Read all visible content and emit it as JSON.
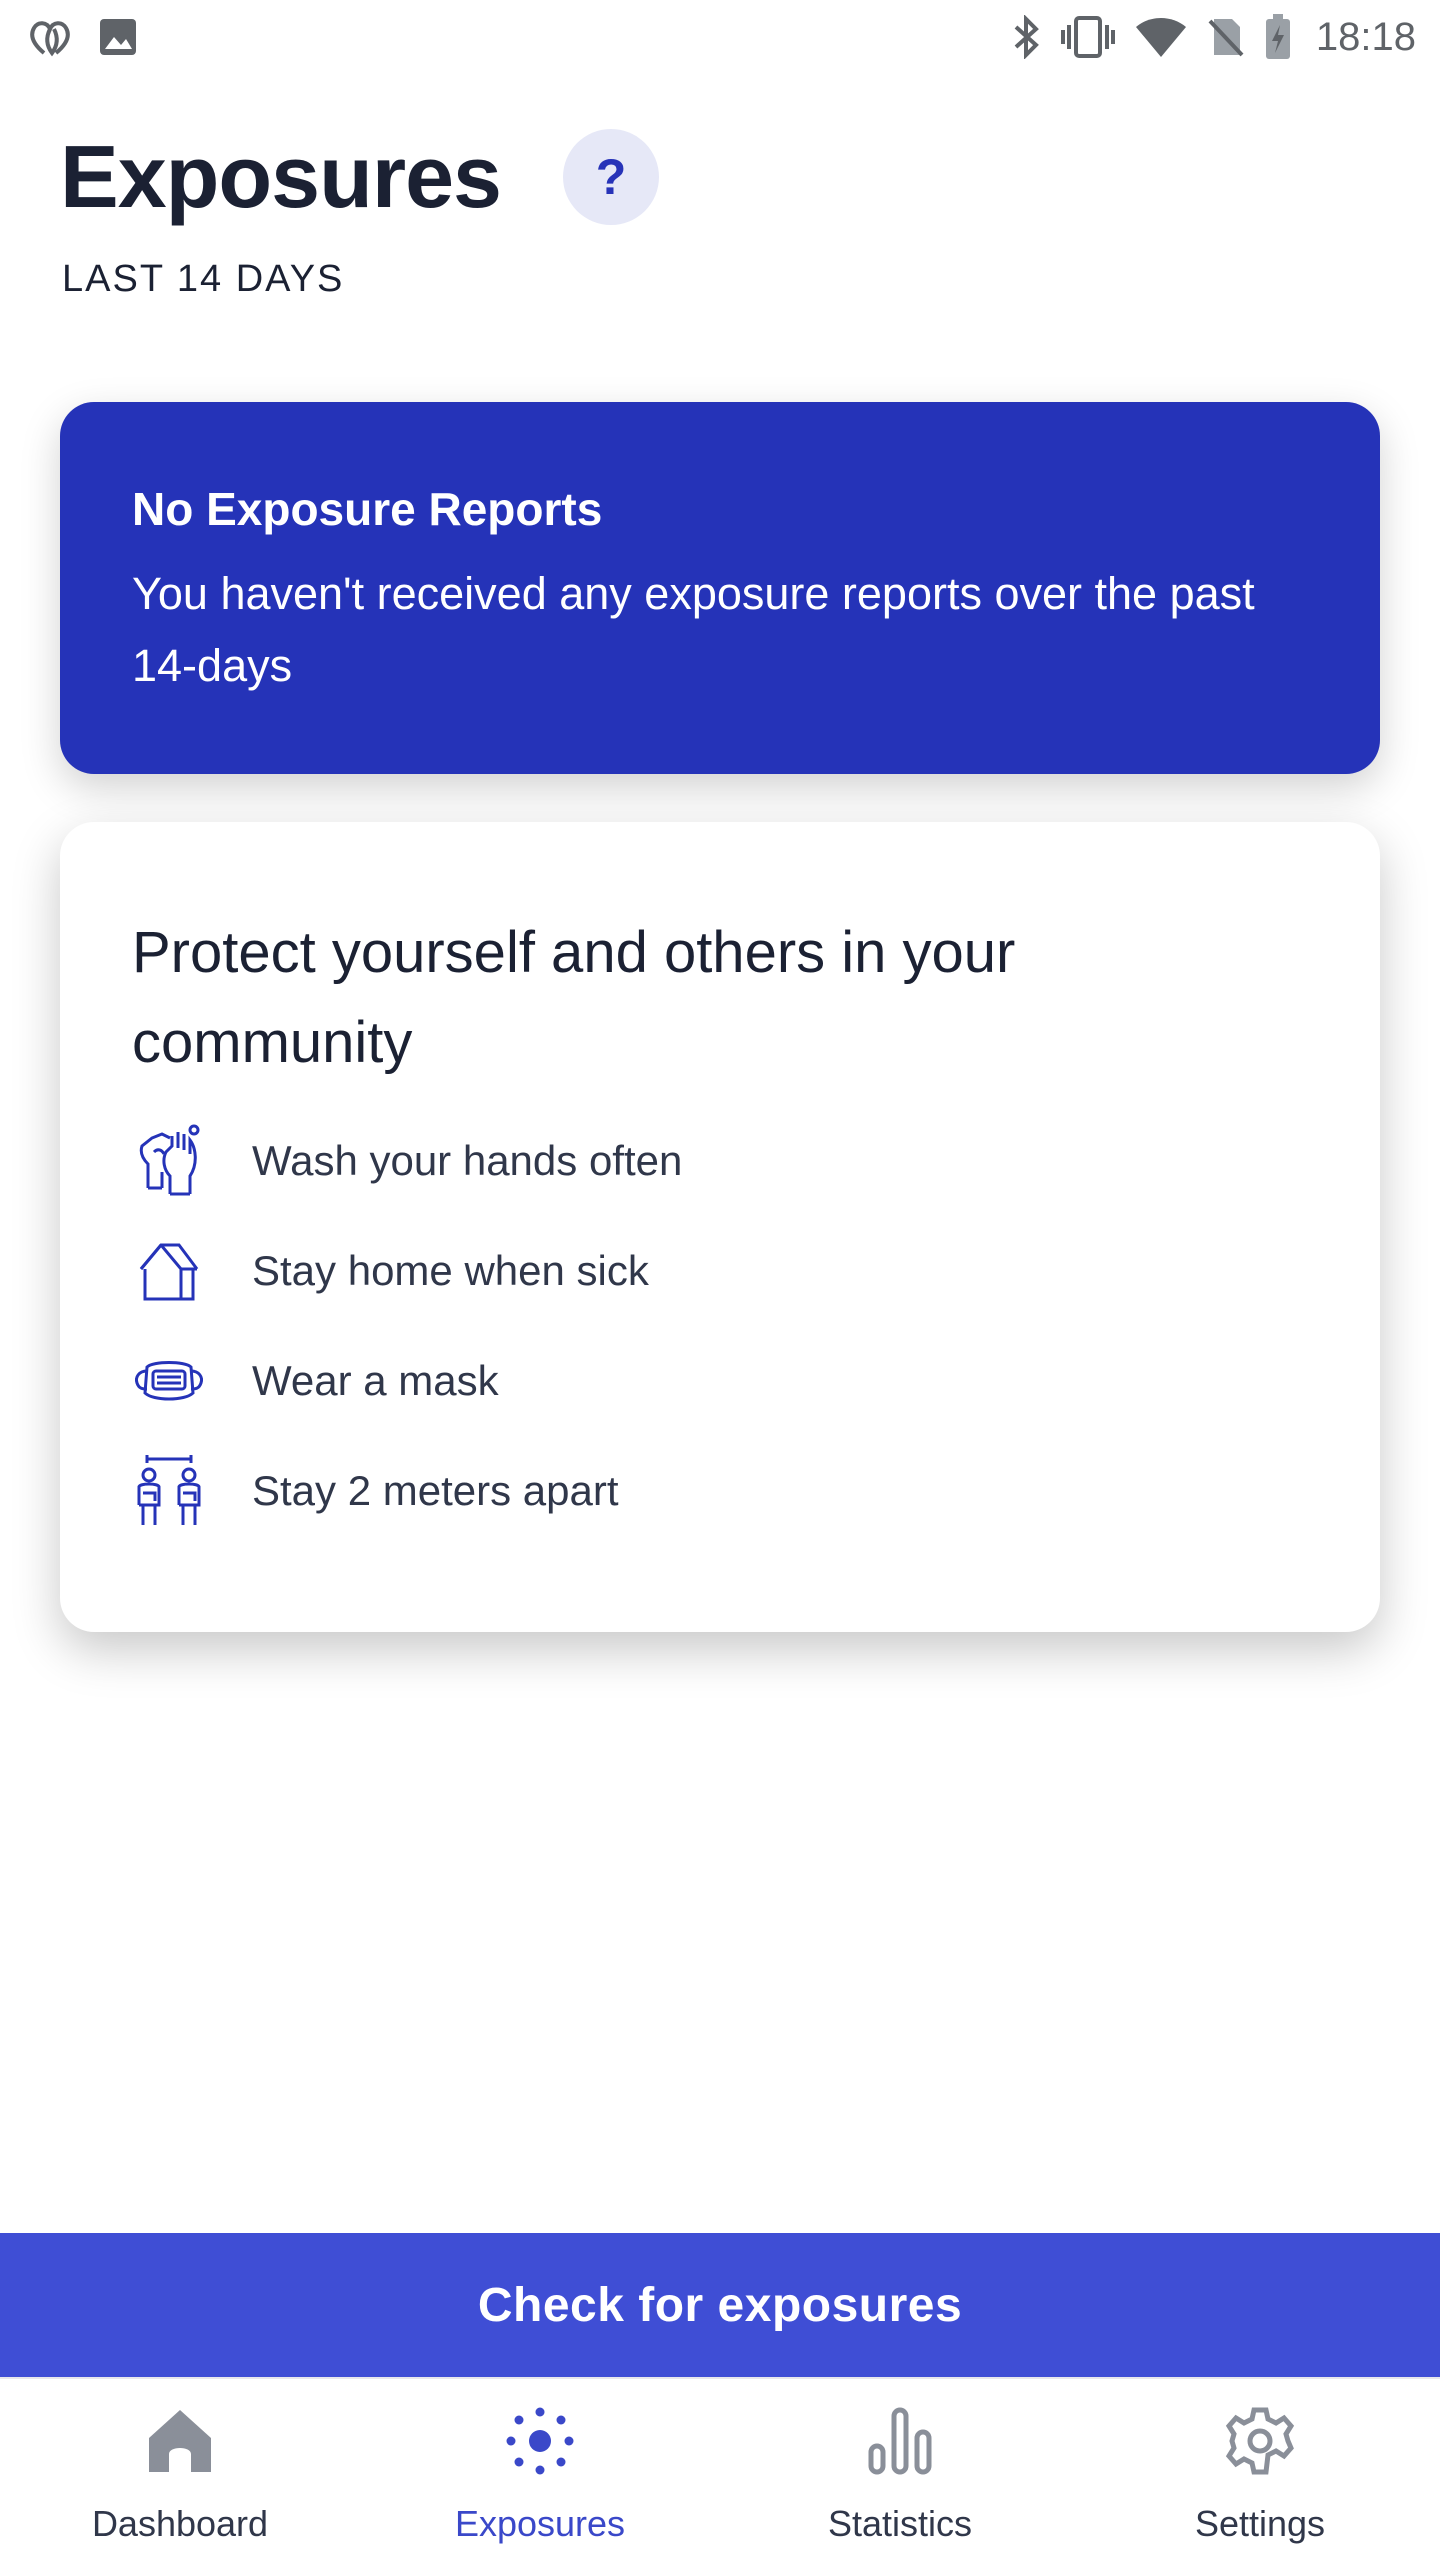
{
  "status_bar": {
    "time": "18:18",
    "left_icons": [
      "heart-outline-icon",
      "image-icon"
    ],
    "right_icons": [
      "bluetooth-icon",
      "vibrate-icon",
      "wifi-icon",
      "no-sim-icon",
      "battery-charging-icon"
    ]
  },
  "header": {
    "title": "Exposures",
    "help_label": "?",
    "subtitle": "LAST 14 DAYS"
  },
  "report_card": {
    "title": "No Exposure Reports",
    "text": "You haven't received any exposure reports over the past 14-days",
    "background": "#2533b8"
  },
  "protect_card": {
    "title": "Protect yourself and others in your community",
    "tips": [
      {
        "label": "Wash your hands often",
        "icon": "hand-wash-icon"
      },
      {
        "label": "Stay home when sick",
        "icon": "house-icon"
      },
      {
        "label": "Wear a mask",
        "icon": "mask-icon"
      },
      {
        "label": "Stay 2 meters apart",
        "icon": "distance-icon"
      }
    ]
  },
  "check_button": {
    "label": "Check for exposures",
    "color": "#3f4ed5"
  },
  "bottom_nav": {
    "items": [
      {
        "label": "Dashboard",
        "icon": "home-icon",
        "active": false
      },
      {
        "label": "Exposures",
        "icon": "exposure-dots-icon",
        "active": true
      },
      {
        "label": "Statistics",
        "icon": "bar-chart-icon",
        "active": false
      },
      {
        "label": "Settings",
        "icon": "gear-icon",
        "active": false
      }
    ],
    "active_color": "#3a48c9"
  }
}
